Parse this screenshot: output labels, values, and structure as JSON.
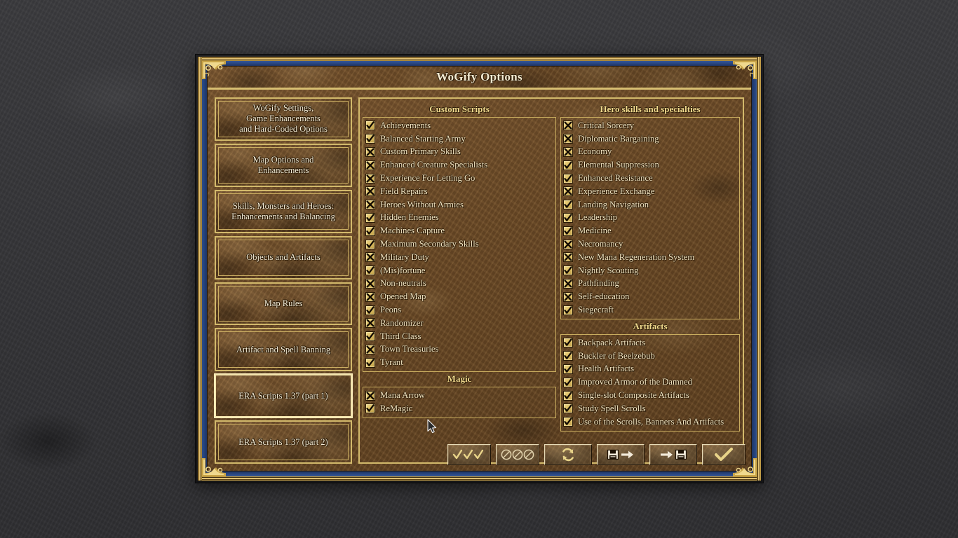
{
  "window": {
    "title": "WoGify Options"
  },
  "sidebar": {
    "items": [
      {
        "label": "WoGify Settings,\nGame Enhancements\nand Hard-Coded Options",
        "selected": false
      },
      {
        "label": "Map Options and\nEnhancements",
        "selected": false
      },
      {
        "label": "Skills, Monsters and Heroes:\nEnhancements and Balancing",
        "selected": false
      },
      {
        "label": "Objects and Artifacts",
        "selected": false
      },
      {
        "label": "Map Rules",
        "selected": false
      },
      {
        "label": "Artifact and Spell Banning",
        "selected": false
      },
      {
        "label": "ERA Scripts 1.37 (part 1)",
        "selected": true
      },
      {
        "label": "ERA Scripts 1.37 (part 2)",
        "selected": false
      }
    ]
  },
  "groups": {
    "custom_scripts": {
      "title": "Custom Scripts",
      "items": [
        {
          "label": "Achievements",
          "state": "checked"
        },
        {
          "label": "Balanced Starting Army",
          "state": "checked"
        },
        {
          "label": "Custom Primary Skills",
          "state": "crossed"
        },
        {
          "label": "Enhanced Creature Specialists",
          "state": "crossed"
        },
        {
          "label": "Experience For Letting Go",
          "state": "crossed"
        },
        {
          "label": "Field Repairs",
          "state": "crossed"
        },
        {
          "label": "Heroes Without Armies",
          "state": "crossed"
        },
        {
          "label": "Hidden Enemies",
          "state": "checked"
        },
        {
          "label": "Machines Capture",
          "state": "checked"
        },
        {
          "label": "Maximum Secondary Skills",
          "state": "checked"
        },
        {
          "label": "Military Duty",
          "state": "crossed"
        },
        {
          "label": "(Mis)fortune",
          "state": "checked"
        },
        {
          "label": "Non-neutrals",
          "state": "crossed"
        },
        {
          "label": "Opened Map",
          "state": "crossed"
        },
        {
          "label": "Peons",
          "state": "checked"
        },
        {
          "label": "Randomizer",
          "state": "crossed"
        },
        {
          "label": "Third Class",
          "state": "checked"
        },
        {
          "label": "Town Treasuries",
          "state": "crossed"
        },
        {
          "label": "Tyrant",
          "state": "checked"
        }
      ]
    },
    "magic": {
      "title": "Magic",
      "items": [
        {
          "label": "Mana Arrow",
          "state": "crossed"
        },
        {
          "label": "ReMagic",
          "state": "checked"
        }
      ]
    },
    "hero_skills": {
      "title": "Hero skills and specialties",
      "items": [
        {
          "label": "Critical Sorcery",
          "state": "crossed"
        },
        {
          "label": "Diplomatic Bargaining",
          "state": "crossed"
        },
        {
          "label": "Economy",
          "state": "crossed"
        },
        {
          "label": "Elemental Suppression",
          "state": "checked"
        },
        {
          "label": "Enhanced Resistance",
          "state": "checked"
        },
        {
          "label": "Experience Exchange",
          "state": "crossed"
        },
        {
          "label": "Landing Navigation",
          "state": "checked"
        },
        {
          "label": "Leadership",
          "state": "checked"
        },
        {
          "label": "Medicine",
          "state": "checked"
        },
        {
          "label": "Necromancy",
          "state": "crossed"
        },
        {
          "label": "New Mana Regeneration System",
          "state": "crossed"
        },
        {
          "label": "Nightly Scouting",
          "state": "checked"
        },
        {
          "label": "Pathfinding",
          "state": "crossed"
        },
        {
          "label": "Self-education",
          "state": "crossed"
        },
        {
          "label": "Siegecraft",
          "state": "checked"
        }
      ]
    },
    "artifacts": {
      "title": "Artifacts",
      "items": [
        {
          "label": "Backpack Artifacts",
          "state": "checked"
        },
        {
          "label": "Buckler of Beelzebub",
          "state": "checked"
        },
        {
          "label": "Health Artifacts",
          "state": "checked"
        },
        {
          "label": "Improved Armor of the Damned",
          "state": "checked"
        },
        {
          "label": "Single-slot Composite Artifacts",
          "state": "checked"
        },
        {
          "label": "Study Spell Scrolls",
          "state": "checked"
        },
        {
          "label": "Use of the Scrolls, Banners And Artifacts",
          "state": "checked"
        }
      ]
    }
  },
  "buttons": [
    {
      "name": "check-all-button",
      "icon": "triple-check-icon",
      "tooltip": "Check all"
    },
    {
      "name": "uncheck-all-button",
      "icon": "triple-ban-icon",
      "tooltip": "Uncheck all"
    },
    {
      "name": "reset-button",
      "icon": "refresh-icon",
      "tooltip": "Reset to defaults"
    },
    {
      "name": "save-button",
      "icon": "save-arrow-icon",
      "tooltip": "Save options"
    },
    {
      "name": "load-button",
      "icon": "arrow-save-icon",
      "tooltip": "Load options"
    },
    {
      "name": "ok-button",
      "icon": "check-icon",
      "tooltip": "OK"
    }
  ],
  "colors": {
    "gold_border": "#d2b96b",
    "gold_text": "#f0d98e",
    "label_text": "#f4e7c4",
    "blue_band": "#1d3465",
    "leather_brown": "#6b4a27",
    "desktop": "#343437"
  }
}
